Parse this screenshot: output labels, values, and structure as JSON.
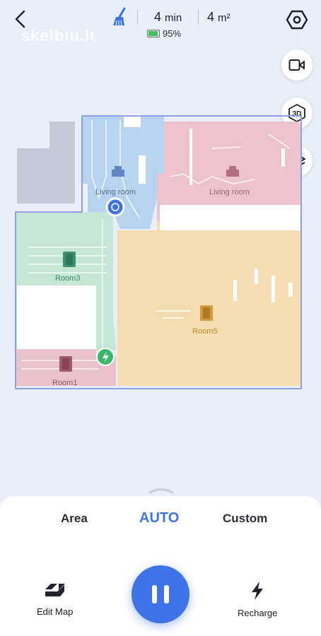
{
  "header": {
    "time_value": "4",
    "time_unit": "min",
    "area_value": "4",
    "area_unit": "m²",
    "battery": "95%",
    "battery_level": 0.95,
    "watermark": "skelbiu.lt"
  },
  "side_buttons": [
    "video-icon",
    "3d-view-icon",
    "layers-icon"
  ],
  "side_3d_label": "3D",
  "rooms": [
    {
      "name": "Living room",
      "color": "#7ea3cf"
    },
    {
      "name": "Living room",
      "color": "#c98a99"
    },
    {
      "name": "Room3",
      "color": "#5aa989"
    },
    {
      "name": "Room5",
      "color": "#d39b3b"
    },
    {
      "name": "Room1",
      "color": "#b4707f"
    }
  ],
  "modes": {
    "area": "Area",
    "auto": "AUTO",
    "custom": "Custom"
  },
  "actions": {
    "edit_map": "Edit Map",
    "recharge": "Recharge"
  },
  "colors": {
    "accent": "#3f74e6",
    "dock": "#3cb66a"
  }
}
